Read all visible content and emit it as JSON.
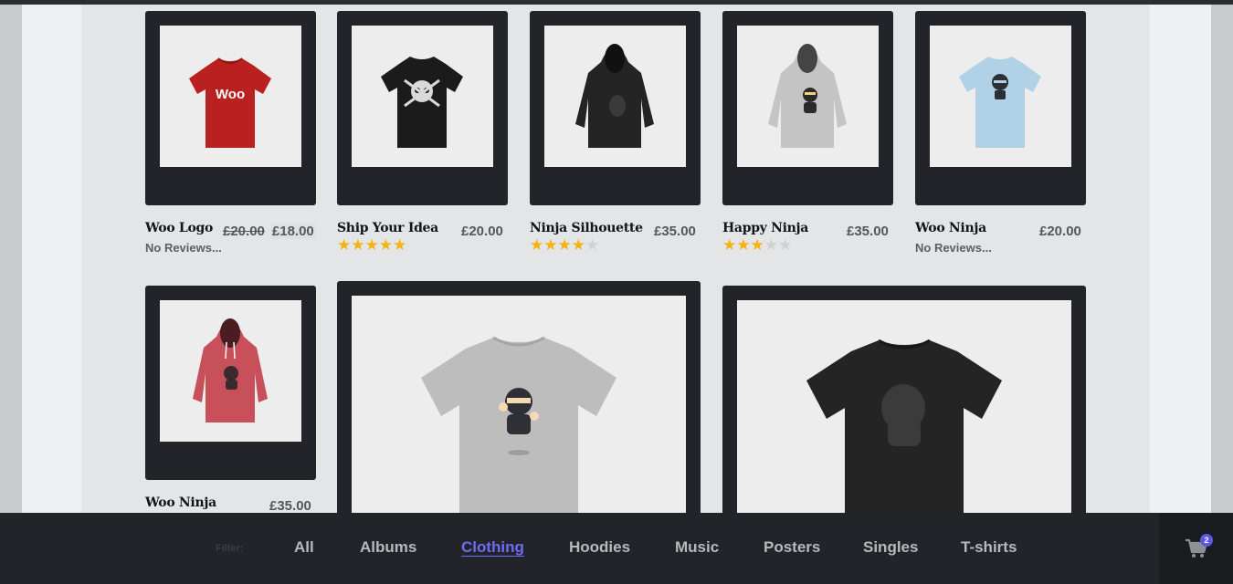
{
  "products": [
    {
      "name": "Woo Logo",
      "old_price": "£20.00",
      "price": "£18.00",
      "rating_text": "No Reviews...",
      "rating": 0
    },
    {
      "name": "Ship Your Idea",
      "price": "£20.00",
      "rating": 4.5
    },
    {
      "name": "Ninja Silhouette",
      "price": "£35.00",
      "rating": 4
    },
    {
      "name": "Happy Ninja",
      "price": "£35.00",
      "rating": 3
    },
    {
      "name": "Woo Ninja",
      "price": "£20.00",
      "rating_text": "No Reviews...",
      "rating": 0
    },
    {
      "name": "Woo Ninja",
      "price": "£35.00",
      "rating": 0
    }
  ],
  "images": {
    "woo_logo_text": "Woo"
  },
  "filter": {
    "label": "Filter:",
    "items": [
      "All",
      "Albums",
      "Clothing",
      "Hoodies",
      "Music",
      "Posters",
      "Singles",
      "T-shirts"
    ],
    "active": "Clothing"
  },
  "cart": {
    "count": "2",
    "icon": "cart-icon"
  },
  "colors": {
    "accent": "#6d6cf5",
    "star": "#f5b40d",
    "card": "#232429"
  }
}
